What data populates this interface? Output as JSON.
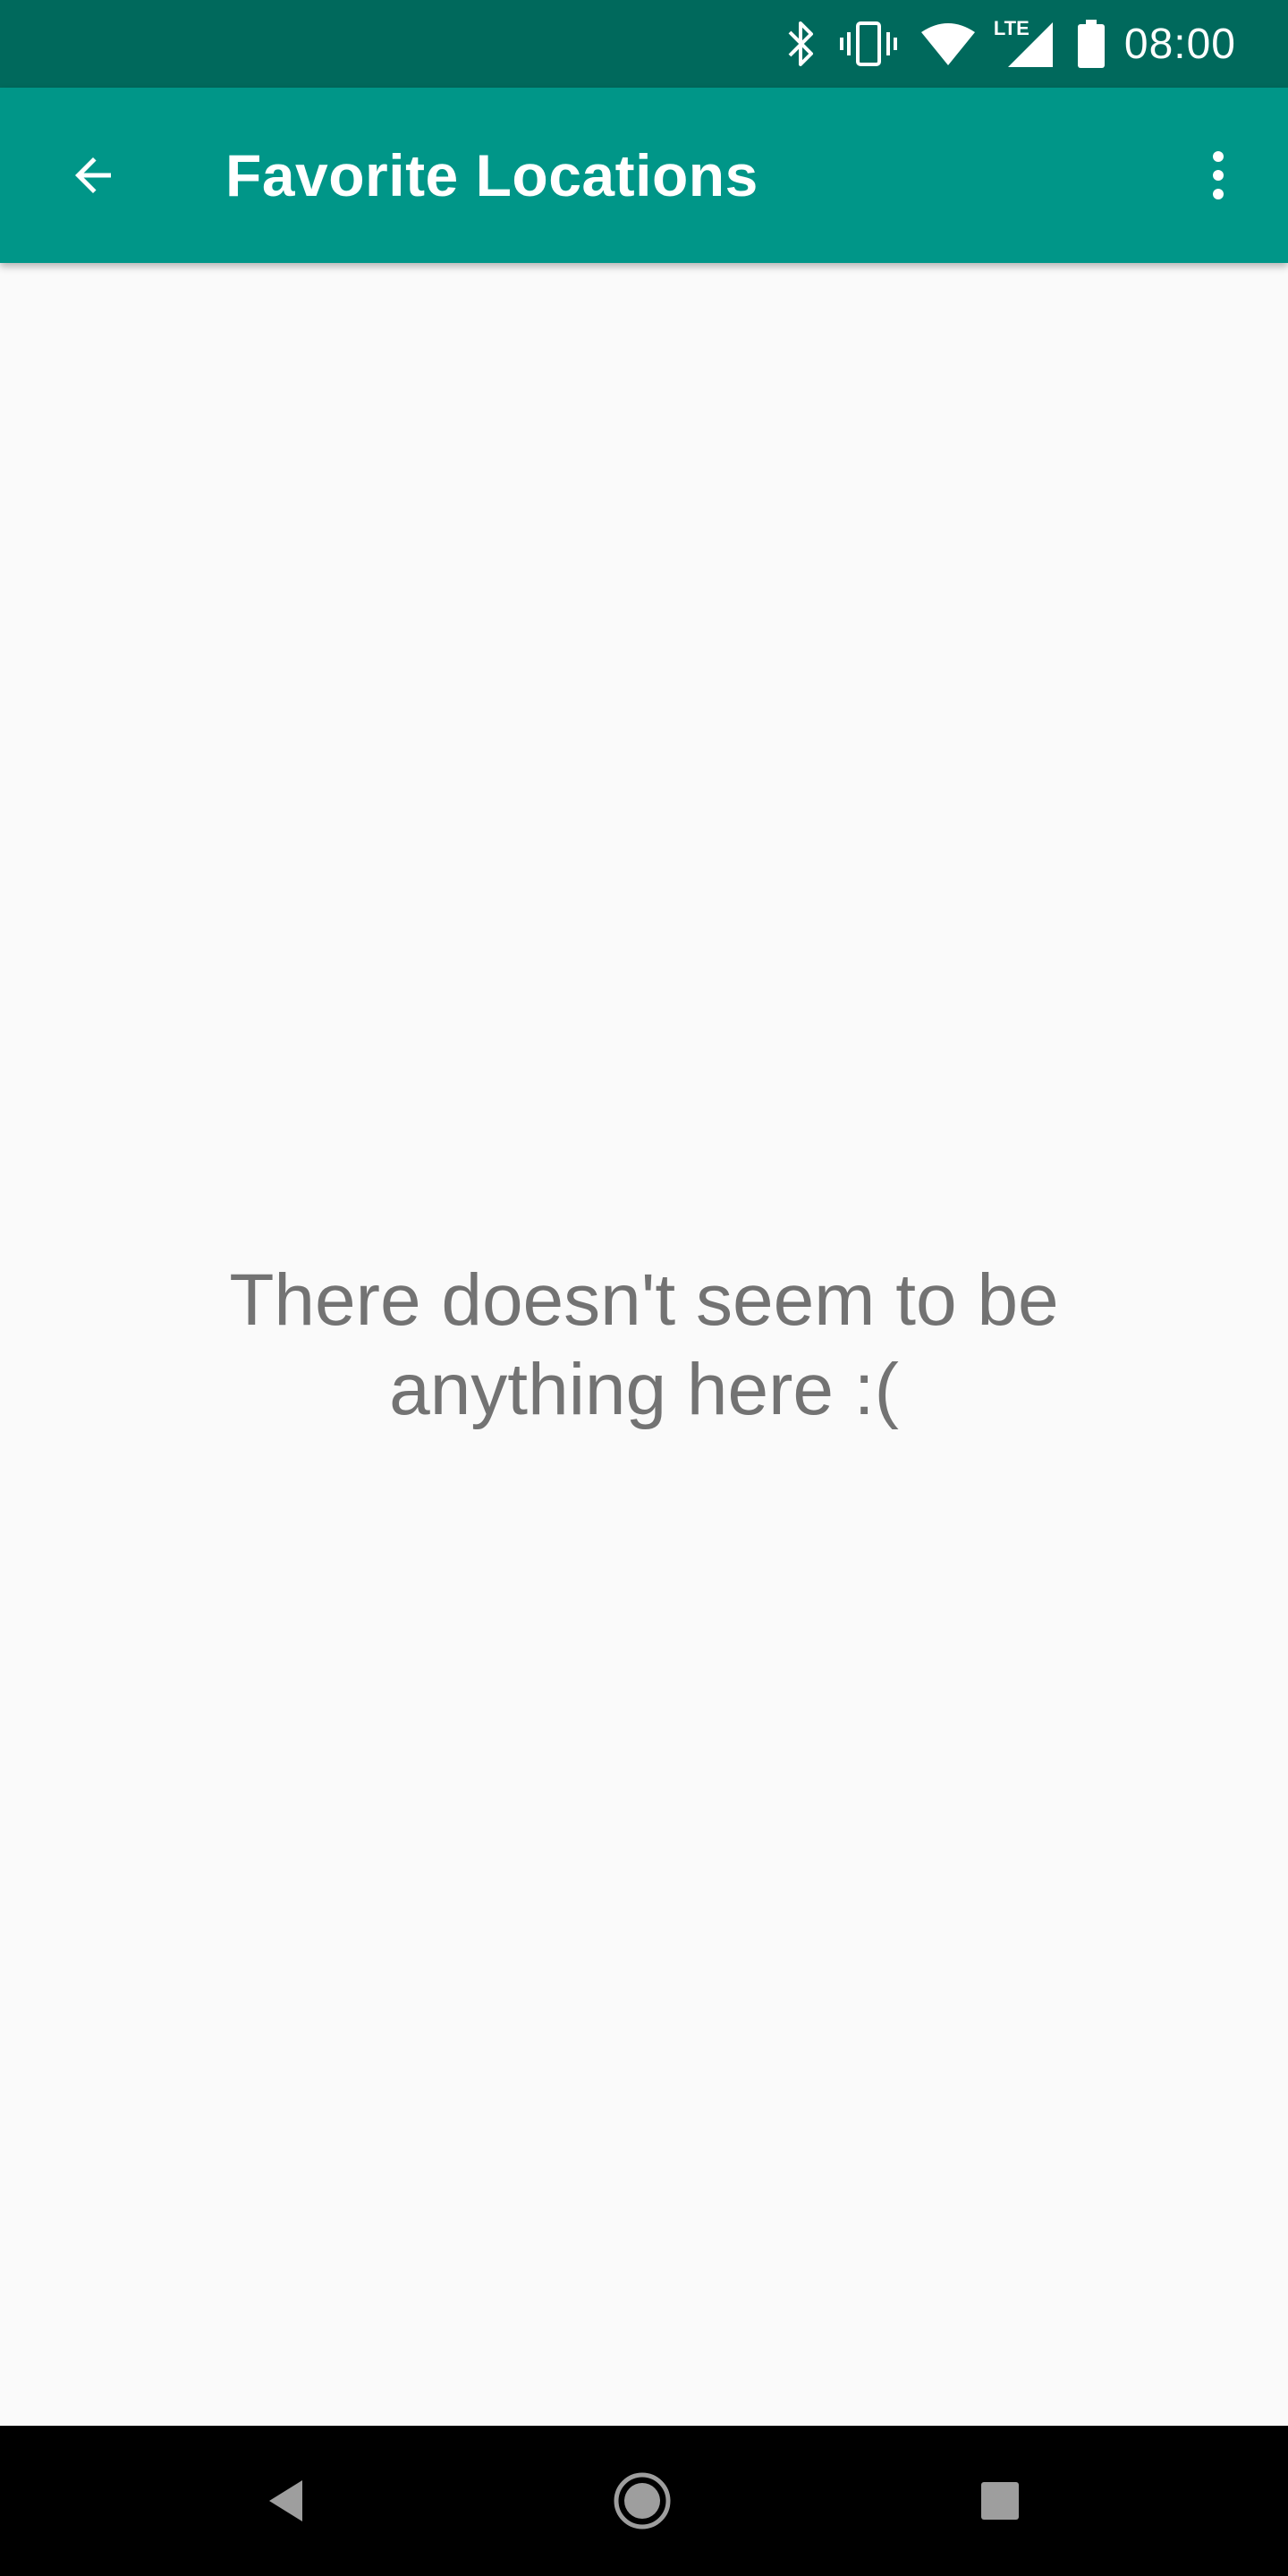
{
  "status_bar": {
    "time": "08:00",
    "network_label": "LTE",
    "icons": [
      "bluetooth-icon",
      "vibrate-icon",
      "wifi-icon",
      "lte-signal-icon",
      "battery-icon"
    ]
  },
  "app_bar": {
    "title": "Favorite Locations",
    "back_icon": "arrow-back-icon",
    "menu_icon": "more-vert-icon",
    "color": "#009688",
    "status_color": "#00695c"
  },
  "content": {
    "empty_line_1": "There doesn't seem to be",
    "empty_line_2": "anything here :("
  },
  "nav_bar": {
    "icons": [
      "back-triangle-icon",
      "home-circle-icon",
      "recents-square-icon"
    ]
  }
}
